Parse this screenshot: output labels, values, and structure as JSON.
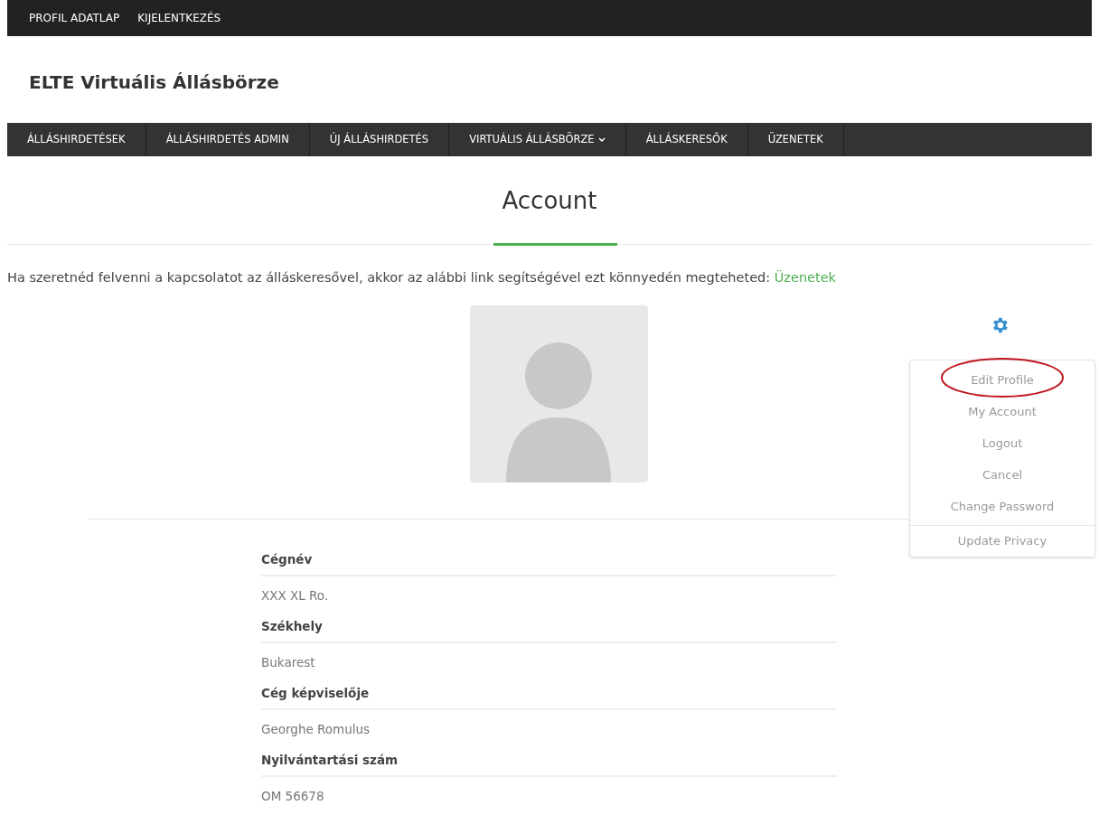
{
  "top_bar": {
    "links": [
      "PROFIL ADATLAP",
      "KIJELENTKEZÉS"
    ]
  },
  "site_title": "ELTE Virtuális Állásbörze",
  "main_nav": [
    {
      "label": "ÁLLÁSHIRDETÉSEK",
      "dropdown": false
    },
    {
      "label": "ÁLLÁSHIRDETÉS ADMIN",
      "dropdown": false
    },
    {
      "label": "ÚJ ÁLLÁSHIRDETÉS",
      "dropdown": false
    },
    {
      "label": "VIRTUÁLIS ÁLLÁSBÖRZE",
      "dropdown": true
    },
    {
      "label": "ÁLLÁSKERESŐK",
      "dropdown": false
    },
    {
      "label": "ÜZENETEK",
      "dropdown": false
    }
  ],
  "page_heading": "Account",
  "intro": {
    "text": "Ha szeretnéd felvenni a kapcsolatot az álláskeresővel, akkor az alábbi link segítségével ezt könnyedén megteheted:",
    "link": "Üzenetek"
  },
  "settings_menu": {
    "items": [
      {
        "label": "Edit Profile",
        "circled": true
      },
      {
        "label": "My Account",
        "circled": false
      },
      {
        "label": "Logout",
        "circled": false
      },
      {
        "label": "Cancel",
        "circled": false
      },
      {
        "label": "Change Password",
        "circled": false
      }
    ],
    "footer_item": "Update Privacy"
  },
  "profile_fields": [
    {
      "label": "Cégnév",
      "value": "XXX XL Ro."
    },
    {
      "label": "Székhely",
      "value": "Bukarest"
    },
    {
      "label": "Cég képviselője",
      "value": "Georghe Romulus"
    },
    {
      "label": "Nyilvántartási szám",
      "value": "OM 56678"
    }
  ]
}
